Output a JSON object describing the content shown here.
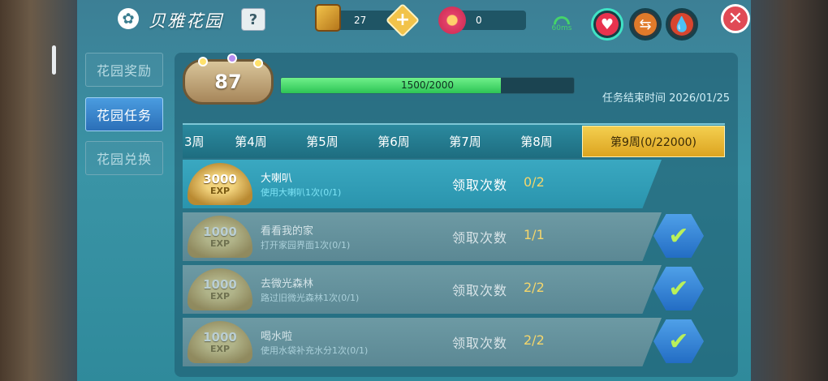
{
  "header": {
    "title": "贝雅花园",
    "help_label": "?",
    "gem_count": "27",
    "plus_label": "+",
    "flower_count": "0",
    "ping": "60ms",
    "close_label": "✕"
  },
  "icons": {
    "logo": "flower-icon",
    "gem": "gem-icon",
    "flower": "flower-currency-icon",
    "signal": "wifi-signal-icon",
    "heart": "heart-icon",
    "swap": "swap-icon",
    "drop": "water-drop-icon",
    "check": "check-icon"
  },
  "sidebar": {
    "items": [
      {
        "label": "花园奖励",
        "active": false
      },
      {
        "label": "花园任务",
        "active": true
      },
      {
        "label": "花园兑换",
        "active": false
      }
    ]
  },
  "level": {
    "value": "87",
    "progress_text": "1500/2000",
    "progress_fraction": 0.75,
    "end_time": "任务结束时间 2026/01/25"
  },
  "tabs": [
    {
      "label": "3周"
    },
    {
      "label": "第4周"
    },
    {
      "label": "第5周"
    },
    {
      "label": "第6周"
    },
    {
      "label": "第7周"
    },
    {
      "label": "第8周"
    },
    {
      "label": "第9周(0/22000)",
      "active": true
    }
  ],
  "tasks": [
    {
      "exp": "3000",
      "exp_label": "EXP",
      "name": "大喇叭",
      "desc": "使用大喇叭1次(0/1)",
      "claim_label": "领取次数",
      "claim_count": "0/2",
      "done": false
    },
    {
      "exp": "1000",
      "exp_label": "EXP",
      "name": "看看我的家",
      "desc": "打开家园界面1次(0/1)",
      "claim_label": "领取次数",
      "claim_count": "1/1",
      "done": true,
      "check": "✔"
    },
    {
      "exp": "1000",
      "exp_label": "EXP",
      "name": "去微光森林",
      "desc": "路过旧微光森林1次(0/1)",
      "claim_label": "领取次数",
      "claim_count": "2/2",
      "done": true,
      "check": "✔"
    },
    {
      "exp": "1000",
      "exp_label": "EXP",
      "name": "喝水啦",
      "desc": "使用水袋补充水分1次(0/1)",
      "claim_label": "领取次数",
      "claim_count": "2/2",
      "done": true,
      "check": "✔"
    }
  ],
  "colors": {
    "panel": "#3a94a6",
    "progress": "#2dc455",
    "active_tab": "#f4cf4f",
    "claim_count": "#f5d66b",
    "check_button": "#236dc4"
  }
}
